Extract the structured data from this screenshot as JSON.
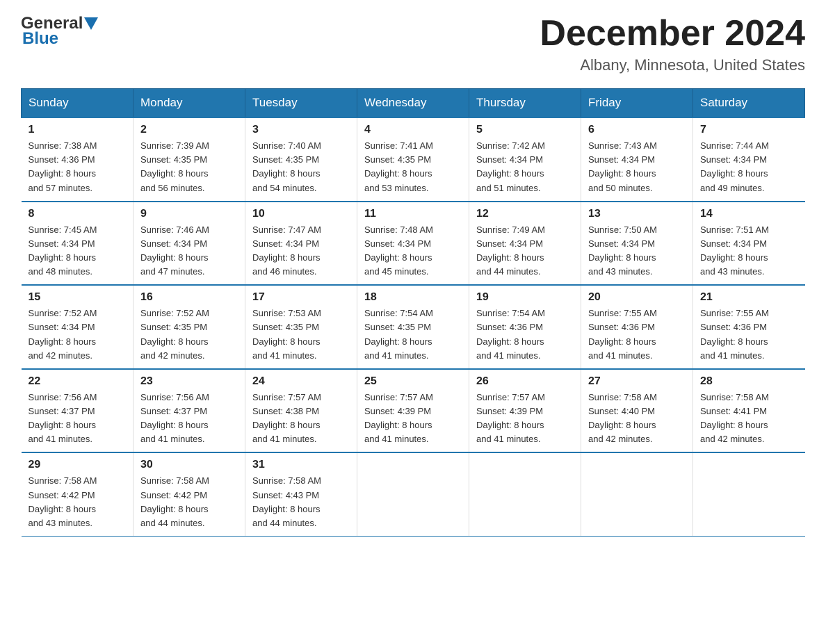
{
  "header": {
    "logo_general": "General",
    "logo_blue": "Blue",
    "month_title": "December 2024",
    "location": "Albany, Minnesota, United States"
  },
  "days_of_week": [
    "Sunday",
    "Monday",
    "Tuesday",
    "Wednesday",
    "Thursday",
    "Friday",
    "Saturday"
  ],
  "weeks": [
    [
      {
        "day": "1",
        "sunrise": "7:38 AM",
        "sunset": "4:36 PM",
        "daylight": "8 hours and 57 minutes."
      },
      {
        "day": "2",
        "sunrise": "7:39 AM",
        "sunset": "4:35 PM",
        "daylight": "8 hours and 56 minutes."
      },
      {
        "day": "3",
        "sunrise": "7:40 AM",
        "sunset": "4:35 PM",
        "daylight": "8 hours and 54 minutes."
      },
      {
        "day": "4",
        "sunrise": "7:41 AM",
        "sunset": "4:35 PM",
        "daylight": "8 hours and 53 minutes."
      },
      {
        "day": "5",
        "sunrise": "7:42 AM",
        "sunset": "4:34 PM",
        "daylight": "8 hours and 51 minutes."
      },
      {
        "day": "6",
        "sunrise": "7:43 AM",
        "sunset": "4:34 PM",
        "daylight": "8 hours and 50 minutes."
      },
      {
        "day": "7",
        "sunrise": "7:44 AM",
        "sunset": "4:34 PM",
        "daylight": "8 hours and 49 minutes."
      }
    ],
    [
      {
        "day": "8",
        "sunrise": "7:45 AM",
        "sunset": "4:34 PM",
        "daylight": "8 hours and 48 minutes."
      },
      {
        "day": "9",
        "sunrise": "7:46 AM",
        "sunset": "4:34 PM",
        "daylight": "8 hours and 47 minutes."
      },
      {
        "day": "10",
        "sunrise": "7:47 AM",
        "sunset": "4:34 PM",
        "daylight": "8 hours and 46 minutes."
      },
      {
        "day": "11",
        "sunrise": "7:48 AM",
        "sunset": "4:34 PM",
        "daylight": "8 hours and 45 minutes."
      },
      {
        "day": "12",
        "sunrise": "7:49 AM",
        "sunset": "4:34 PM",
        "daylight": "8 hours and 44 minutes."
      },
      {
        "day": "13",
        "sunrise": "7:50 AM",
        "sunset": "4:34 PM",
        "daylight": "8 hours and 43 minutes."
      },
      {
        "day": "14",
        "sunrise": "7:51 AM",
        "sunset": "4:34 PM",
        "daylight": "8 hours and 43 minutes."
      }
    ],
    [
      {
        "day": "15",
        "sunrise": "7:52 AM",
        "sunset": "4:34 PM",
        "daylight": "8 hours and 42 minutes."
      },
      {
        "day": "16",
        "sunrise": "7:52 AM",
        "sunset": "4:35 PM",
        "daylight": "8 hours and 42 minutes."
      },
      {
        "day": "17",
        "sunrise": "7:53 AM",
        "sunset": "4:35 PM",
        "daylight": "8 hours and 41 minutes."
      },
      {
        "day": "18",
        "sunrise": "7:54 AM",
        "sunset": "4:35 PM",
        "daylight": "8 hours and 41 minutes."
      },
      {
        "day": "19",
        "sunrise": "7:54 AM",
        "sunset": "4:36 PM",
        "daylight": "8 hours and 41 minutes."
      },
      {
        "day": "20",
        "sunrise": "7:55 AM",
        "sunset": "4:36 PM",
        "daylight": "8 hours and 41 minutes."
      },
      {
        "day": "21",
        "sunrise": "7:55 AM",
        "sunset": "4:36 PM",
        "daylight": "8 hours and 41 minutes."
      }
    ],
    [
      {
        "day": "22",
        "sunrise": "7:56 AM",
        "sunset": "4:37 PM",
        "daylight": "8 hours and 41 minutes."
      },
      {
        "day": "23",
        "sunrise": "7:56 AM",
        "sunset": "4:37 PM",
        "daylight": "8 hours and 41 minutes."
      },
      {
        "day": "24",
        "sunrise": "7:57 AM",
        "sunset": "4:38 PM",
        "daylight": "8 hours and 41 minutes."
      },
      {
        "day": "25",
        "sunrise": "7:57 AM",
        "sunset": "4:39 PM",
        "daylight": "8 hours and 41 minutes."
      },
      {
        "day": "26",
        "sunrise": "7:57 AM",
        "sunset": "4:39 PM",
        "daylight": "8 hours and 41 minutes."
      },
      {
        "day": "27",
        "sunrise": "7:58 AM",
        "sunset": "4:40 PM",
        "daylight": "8 hours and 42 minutes."
      },
      {
        "day": "28",
        "sunrise": "7:58 AM",
        "sunset": "4:41 PM",
        "daylight": "8 hours and 42 minutes."
      }
    ],
    [
      {
        "day": "29",
        "sunrise": "7:58 AM",
        "sunset": "4:42 PM",
        "daylight": "8 hours and 43 minutes."
      },
      {
        "day": "30",
        "sunrise": "7:58 AM",
        "sunset": "4:42 PM",
        "daylight": "8 hours and 44 minutes."
      },
      {
        "day": "31",
        "sunrise": "7:58 AM",
        "sunset": "4:43 PM",
        "daylight": "8 hours and 44 minutes."
      },
      {
        "day": "",
        "sunrise": "",
        "sunset": "",
        "daylight": ""
      },
      {
        "day": "",
        "sunrise": "",
        "sunset": "",
        "daylight": ""
      },
      {
        "day": "",
        "sunrise": "",
        "sunset": "",
        "daylight": ""
      },
      {
        "day": "",
        "sunrise": "",
        "sunset": "",
        "daylight": ""
      }
    ]
  ],
  "labels": {
    "sunrise": "Sunrise: ",
    "sunset": "Sunset: ",
    "daylight": "Daylight: "
  }
}
